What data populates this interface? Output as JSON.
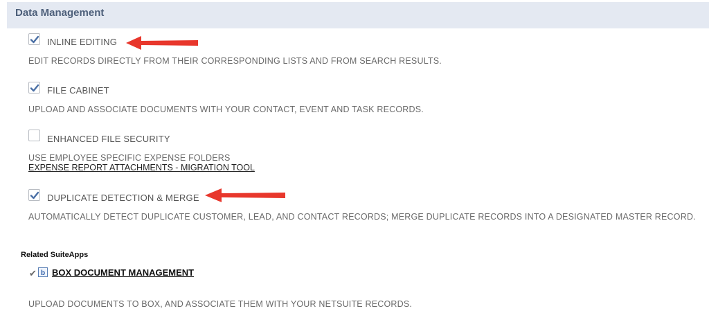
{
  "section": {
    "title": "Data Management"
  },
  "features": [
    {
      "label": "INLINE EDITING",
      "checked": true,
      "description": "EDIT RECORDS DIRECTLY FROM THEIR CORRESPONDING LISTS AND FROM SEARCH RESULTS."
    },
    {
      "label": "FILE CABINET",
      "checked": true,
      "description": "UPLOAD AND ASSOCIATE DOCUMENTS WITH YOUR CONTACT, EVENT AND TASK RECORDS."
    },
    {
      "label": "ENHANCED FILE SECURITY",
      "checked": false,
      "description": "USE EMPLOYEE SPECIFIC EXPENSE FOLDERS",
      "link": "EXPENSE REPORT ATTACHMENTS - MIGRATION TOOL"
    },
    {
      "label": "DUPLICATE DETECTION & MERGE",
      "checked": true,
      "description": "AUTOMATICALLY DETECT DUPLICATE CUSTOMER, LEAD, AND CONTACT RECORDS; MERGE DUPLICATE RECORDS INTO A DESIGNATED MASTER RECORD."
    }
  ],
  "related": {
    "heading": "Related SuiteApps",
    "app_name": "BOX DOCUMENT MANAGEMENT",
    "app_description": "UPLOAD DOCUMENTS TO BOX, AND ASSOCIATE THEM WITH YOUR NETSUITE RECORDS.",
    "installed": true
  },
  "colors": {
    "accent_arrow": "#e8372c",
    "check": "#4a6fa5",
    "header_bg": "#e4e9f2"
  }
}
